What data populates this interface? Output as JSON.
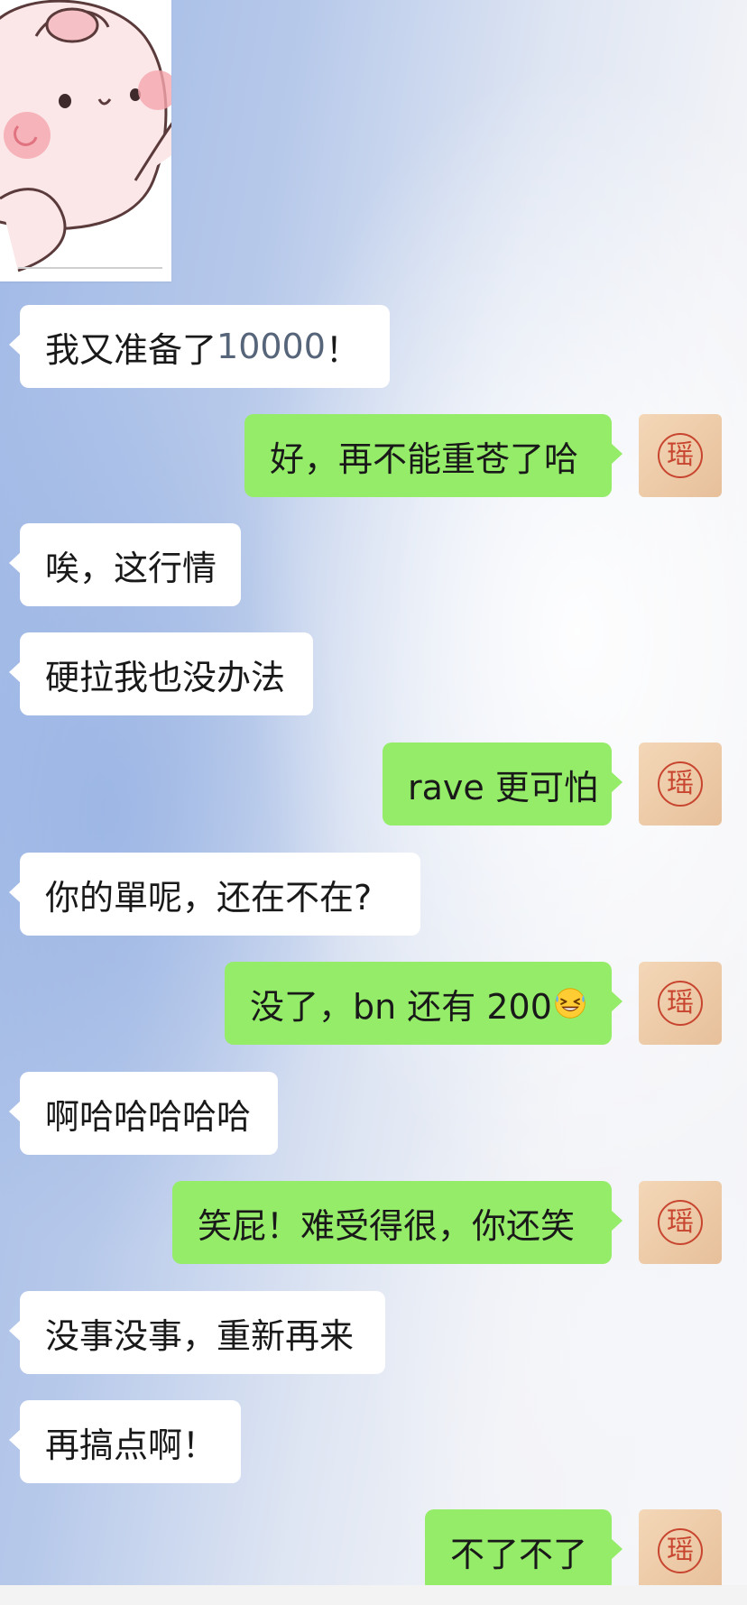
{
  "chat": {
    "avatar_text": "瑶",
    "messages": [
      {
        "side": "left",
        "text": "我又准备了 ",
        "num": "10000",
        "suffix": "！"
      },
      {
        "side": "right",
        "text": "好，再不能重苍了哈"
      },
      {
        "side": "left",
        "text": "唉，这行情"
      },
      {
        "side": "left",
        "text": "硬拉我也没办法"
      },
      {
        "side": "right",
        "text": "rave 更可怕"
      },
      {
        "side": "left",
        "text": "你的單呢，还在不在?"
      },
      {
        "side": "right",
        "text": "没了，bn 还有 200",
        "emoji": "grinning-sweat-emoji"
      },
      {
        "side": "left",
        "text": "啊哈哈哈哈哈"
      },
      {
        "side": "right",
        "text": "笑屁！难受得很，你还笑"
      },
      {
        "side": "left",
        "text": "没事没事，重新再来"
      },
      {
        "side": "left",
        "text": "再搞点啊！"
      },
      {
        "side": "right",
        "text": "不了不了"
      }
    ]
  }
}
